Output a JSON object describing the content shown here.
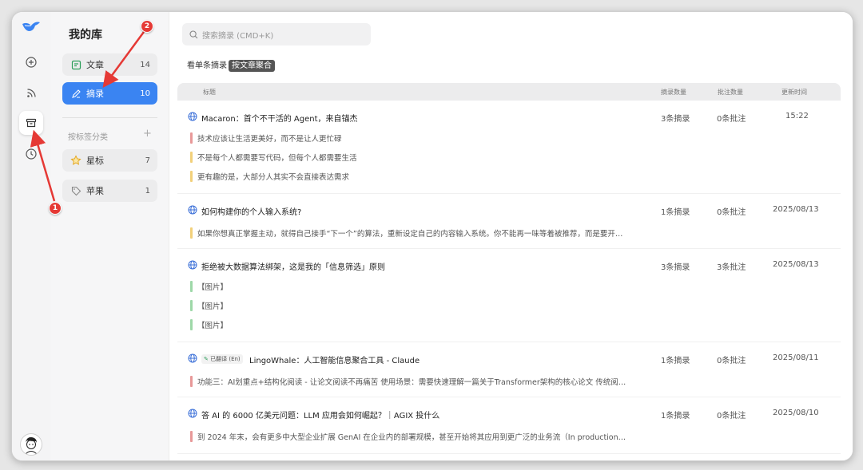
{
  "library": {
    "title": "我的库",
    "items": [
      {
        "label": "文章",
        "count": "14"
      },
      {
        "label": "摘录",
        "count": "10"
      }
    ],
    "tag_section": "按标签分类",
    "tag_add": "+",
    "tags": [
      {
        "label": "星标",
        "count": "7"
      },
      {
        "label": "苹果",
        "count": "1"
      }
    ]
  },
  "search": {
    "placeholder": "搜索摘录 (CMD+K)"
  },
  "view_toggle": {
    "single": "看单条摘录",
    "aggregate": "按文章聚合"
  },
  "table": {
    "headers": {
      "title": "标题",
      "excerpts": "摘录数量",
      "notes": "批注数量",
      "updated": "更新时间"
    },
    "rows": [
      {
        "title": "Macaron：首个不干活的 Agent，来自锚杰",
        "excerpt_count": "3条摘录",
        "note_count": "0条批注",
        "updated": "15:22",
        "excerpts": [
          {
            "text": "技术应该让生活更美好，而不是让人更忙碌",
            "color": "#e89999"
          },
          {
            "text": "不是每个人都需要写代码，但每个人都需要生活",
            "color": "#f2d07a"
          },
          {
            "text": "更有趣的是，大部分人其实不会直接表达需求",
            "color": "#f2d07a"
          }
        ]
      },
      {
        "title": "如何构建你的个人输入系统?",
        "excerpt_count": "1条摘录",
        "note_count": "0条批注",
        "updated": "2025/08/13",
        "excerpts": [
          {
            "text": "如果你想真正掌握主动，就得自己接手“下一个”的算法，重新设定自己的内容输入系统。你不能再一味等着被推荐，而是要开…",
            "color": "#f2d07a"
          }
        ]
      },
      {
        "title": "拒绝被大数据算法绑架，这是我的「信息筛选」原则",
        "excerpt_count": "3条摘录",
        "note_count": "3条批注",
        "updated": "2025/08/13",
        "excerpts": [
          {
            "text": "【图片】",
            "color": "#9ed8a8"
          },
          {
            "text": "【图片】",
            "color": "#9ed8a8"
          },
          {
            "text": "【图片】",
            "color": "#9ed8a8"
          }
        ]
      },
      {
        "badge": "已翻译 (En)",
        "title": "LingoWhale：人工智能信息聚合工具 - Claude",
        "excerpt_count": "1条摘录",
        "note_count": "0条批注",
        "updated": "2025/08/11",
        "excerpts": [
          {
            "text": "功能三：AI划重点+结构化阅读 - 让论文阅读不再痛苦 使用场景：需要快速理解一篇关于Transformer架构的核心论文 传统阅…",
            "color": "#e89999"
          }
        ]
      },
      {
        "title": "答 AI 的 6000 亿美元问题：LLM 应用会如何崛起？｜AGIX 投什么",
        "excerpt_count": "1条摘录",
        "note_count": "0条批注",
        "updated": "2025/08/10",
        "excerpts": [
          {
            "text": "到 2024 年末，会有更多中大型企业扩展 GenAI 在企业内的部署规模，甚至开始将其应用到更广泛的业务流（In production…",
            "color": "#e89999"
          }
        ]
      }
    ]
  },
  "annotations": [
    "1",
    "2"
  ]
}
